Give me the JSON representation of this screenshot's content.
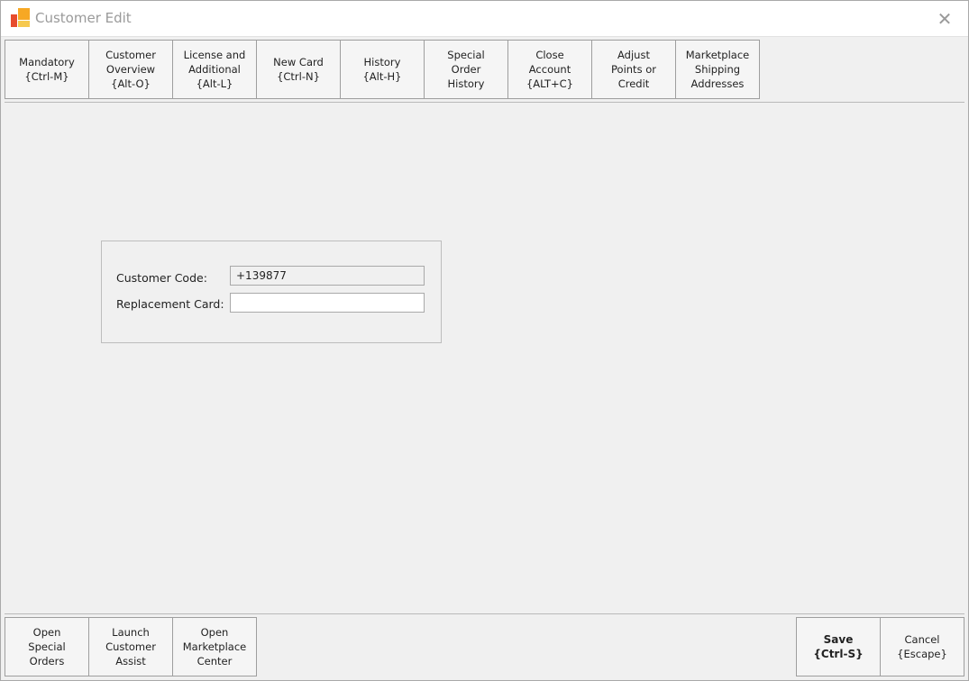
{
  "window": {
    "title": "Customer Edit",
    "close_glyph": "✕",
    "icon": "app-logo-icon"
  },
  "toolbar": {
    "buttons": [
      {
        "label": "Mandatory\n{Ctrl-M}"
      },
      {
        "label": "Customer\nOverview\n{Alt-O}"
      },
      {
        "label": "License and\nAdditional\n{Alt-L}"
      },
      {
        "label": "New Card\n{Ctrl-N}"
      },
      {
        "label": "History\n{Alt-H}"
      },
      {
        "label": "Special\nOrder\nHistory"
      },
      {
        "label": "Close\nAccount\n{ALT+C}"
      },
      {
        "label": "Adjust\nPoints or\nCredit"
      },
      {
        "label": "Marketplace\nShipping\nAddresses"
      }
    ]
  },
  "form": {
    "customer_code_label": "Customer Code:",
    "customer_code_value": "+139877",
    "replacement_card_label": "Replacement Card:",
    "replacement_card_value": ""
  },
  "footer": {
    "left_buttons": [
      {
        "label": "Open\nSpecial\nOrders"
      },
      {
        "label": "Launch\nCustomer\nAssist"
      },
      {
        "label": "Open\nMarketplace\nCenter"
      }
    ],
    "save_label": "Save\n{Ctrl-S}",
    "cancel_label": "Cancel\n{Escape}"
  }
}
